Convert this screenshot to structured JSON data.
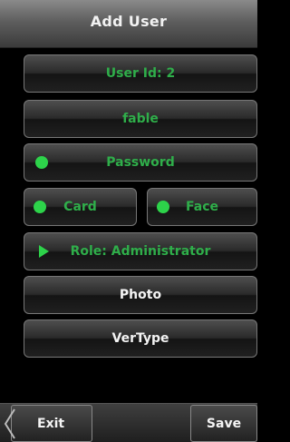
{
  "header": {
    "title": "Add User"
  },
  "form": {
    "user_id": "User Id: 2",
    "name": "fable",
    "password": "Password",
    "card": "Card",
    "face": "Face",
    "role": "Role: Administrator",
    "photo": "Photo",
    "vertype": "VerType"
  },
  "footer": {
    "exit": "Exit",
    "save": "Save"
  },
  "colors": {
    "accent_green": "#2fae4a",
    "indicator": "#2dd34a",
    "background": "#000000"
  }
}
